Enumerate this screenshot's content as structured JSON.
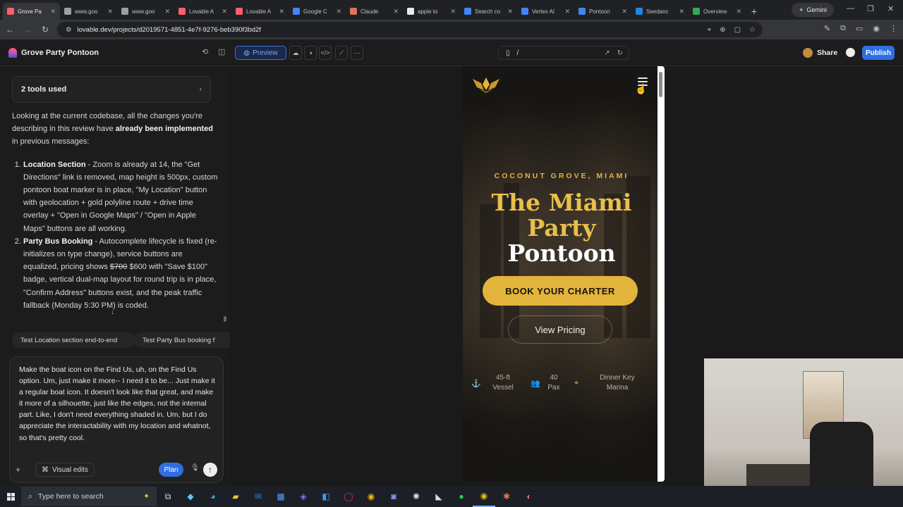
{
  "browser": {
    "tabs": [
      {
        "label": "Grove Pa",
        "color": "#ff5f6d",
        "active": true
      },
      {
        "label": "www.goo",
        "color": "#9aa0a6"
      },
      {
        "label": "www.goo",
        "color": "#9aa0a6"
      },
      {
        "label": "Lovable A",
        "color": "#ff5f6d"
      },
      {
        "label": "Lovable A",
        "color": "#ff5f6d"
      },
      {
        "label": "Google C",
        "color": "#4285f4"
      },
      {
        "label": "Claude",
        "color": "#d97757"
      },
      {
        "label": "apple to",
        "color": "#e8eaed"
      },
      {
        "label": "Search co",
        "color": "#4285f4"
      },
      {
        "label": "Vertex AI",
        "color": "#4285f4"
      },
      {
        "label": "Pontoon",
        "color": "#4285f4"
      },
      {
        "label": "Seedanc",
        "color": "#1e88e5"
      },
      {
        "label": "Overview",
        "color": "#34a853"
      }
    ],
    "gemini_label": "Gemini",
    "url": "lovable.dev/projects/d2019571-4851-4e7f-9276-beb390f3bd2f"
  },
  "app": {
    "project_name": "Grove Party Pontoon",
    "preview_label": "Preview",
    "path": "/",
    "share_label": "Share",
    "publish_label": "Publish"
  },
  "chat": {
    "tools_used": "2 tools used",
    "intro_pre": "Looking at the current codebase, all the changes you're describing in this review have ",
    "intro_bold": "already been implemented",
    "intro_post": " in previous messages:",
    "items": [
      {
        "title": "Location Section",
        "text": " - Zoom is already at 14, the \"Get Directions\" link is removed, map height is 500px, custom pontoon boat marker is in place, \"My Location\" button with geolocation + gold polyline route + drive time overlay + \"Open in Google Maps\" / \"Open in Apple Maps\" buttons are all working."
      },
      {
        "title": "Party Bus Booking",
        "text_pre": " - Autocomplete lifecycle is fixed (re-initializes on type change), service buttons are equalized, pricing shows ",
        "strike": "$700",
        "text_post": " $600 with \"Save $100\" badge, vertical dual-map layout for round trip is in place, \"Confirm Address\" buttons exist, and the peak traffic fallback (Monday 5:30 PM) is coded."
      }
    ],
    "suggestions": [
      "Test Location section end-to-end",
      "Test Party Bus booking f"
    ],
    "draft": "Make the boat icon on the Find Us, uh, on the Find Us option. Um, just make it more-- I need it to be... Just make it a regular boat icon. It doesn't look like that great, and make it more of a silhouette, just like the edges, not the internal part. Like, I don't need everything shaded in. Um, but I do appreciate the interactability with my location and whatnot, so that's pretty cool.",
    "visual_edits_label": "Visual edits",
    "plan_label": "Plan"
  },
  "site": {
    "eyebrow": "COCONUT GROVE, MIAMI",
    "title_gold_line1": "The Miami",
    "title_gold_line2": "Party",
    "title_white": "Pontoon",
    "cta_primary": "BOOK YOUR CHARTER",
    "cta_secondary": "View Pricing",
    "stats": [
      {
        "icon": "anchor-icon",
        "line1": "45-ft",
        "line2": "Vessel"
      },
      {
        "icon": "users-icon",
        "line1": "40",
        "line2": "Pax"
      },
      {
        "icon": "map-pin-icon",
        "line1": "Dinner Key",
        "line2": "Marina"
      }
    ],
    "accent": "#e2b43c"
  },
  "taskbar": {
    "search_placeholder": "Type here to search"
  }
}
